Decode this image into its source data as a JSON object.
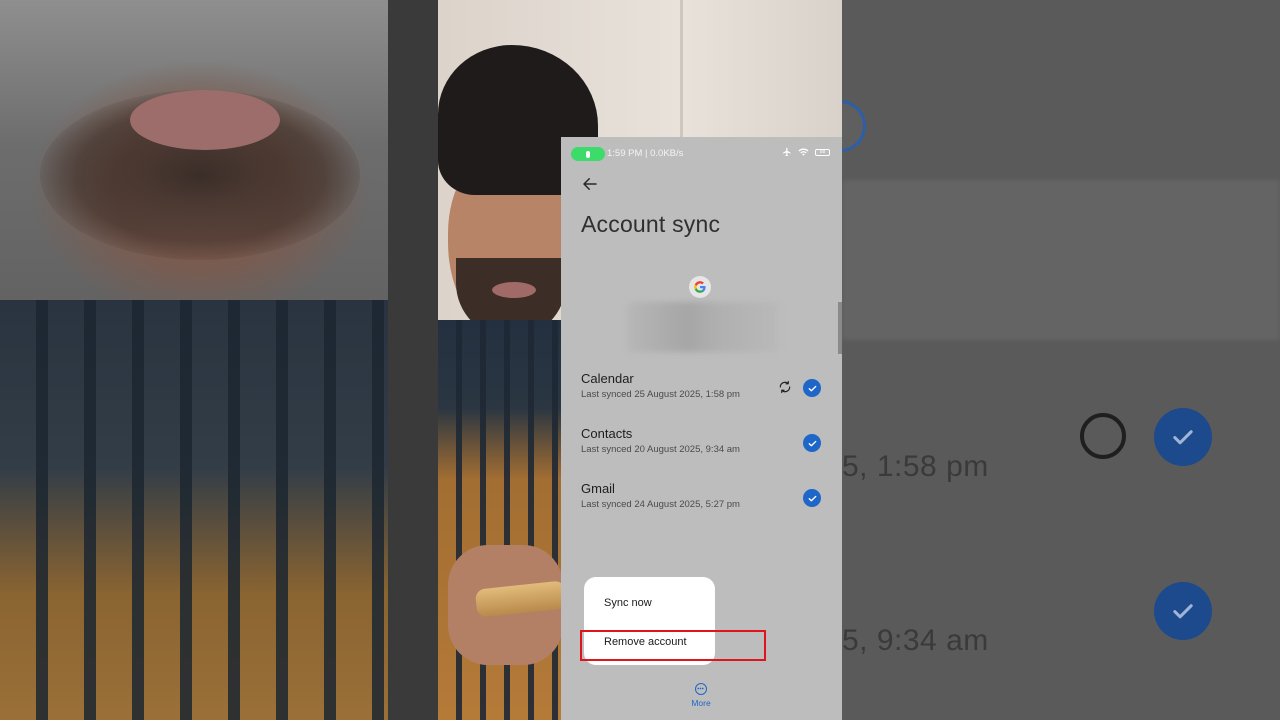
{
  "status_bar": {
    "text": "1:59 PM | 0.0KB/s",
    "battery": "88",
    "icons": [
      "airplane-icon",
      "wifi-icon",
      "battery-icon"
    ]
  },
  "header": {
    "title": "Account sync"
  },
  "sync_items": [
    {
      "title": "Calendar",
      "subtitle": "Last synced 25 August 2025, 1:58 pm",
      "checked": true,
      "syncing": true
    },
    {
      "title": "Contacts",
      "subtitle": "Last synced 20 August 2025, 9:34 am",
      "checked": true,
      "syncing": false
    },
    {
      "title": "Gmail",
      "subtitle": "Last synced 24 August 2025, 5:27 pm",
      "checked": true,
      "syncing": false
    }
  ],
  "menu": {
    "items": [
      "Sync now",
      "Remove account"
    ]
  },
  "bottom_bar": {
    "more_label": "More"
  },
  "background_zoom": {
    "text_1": "5, 1:58 pm",
    "text_2": "5, 9:34 am"
  },
  "colors": {
    "accent": "#1f66c9",
    "highlight": "#e0141c",
    "status_pill": "#3ddc6a"
  }
}
